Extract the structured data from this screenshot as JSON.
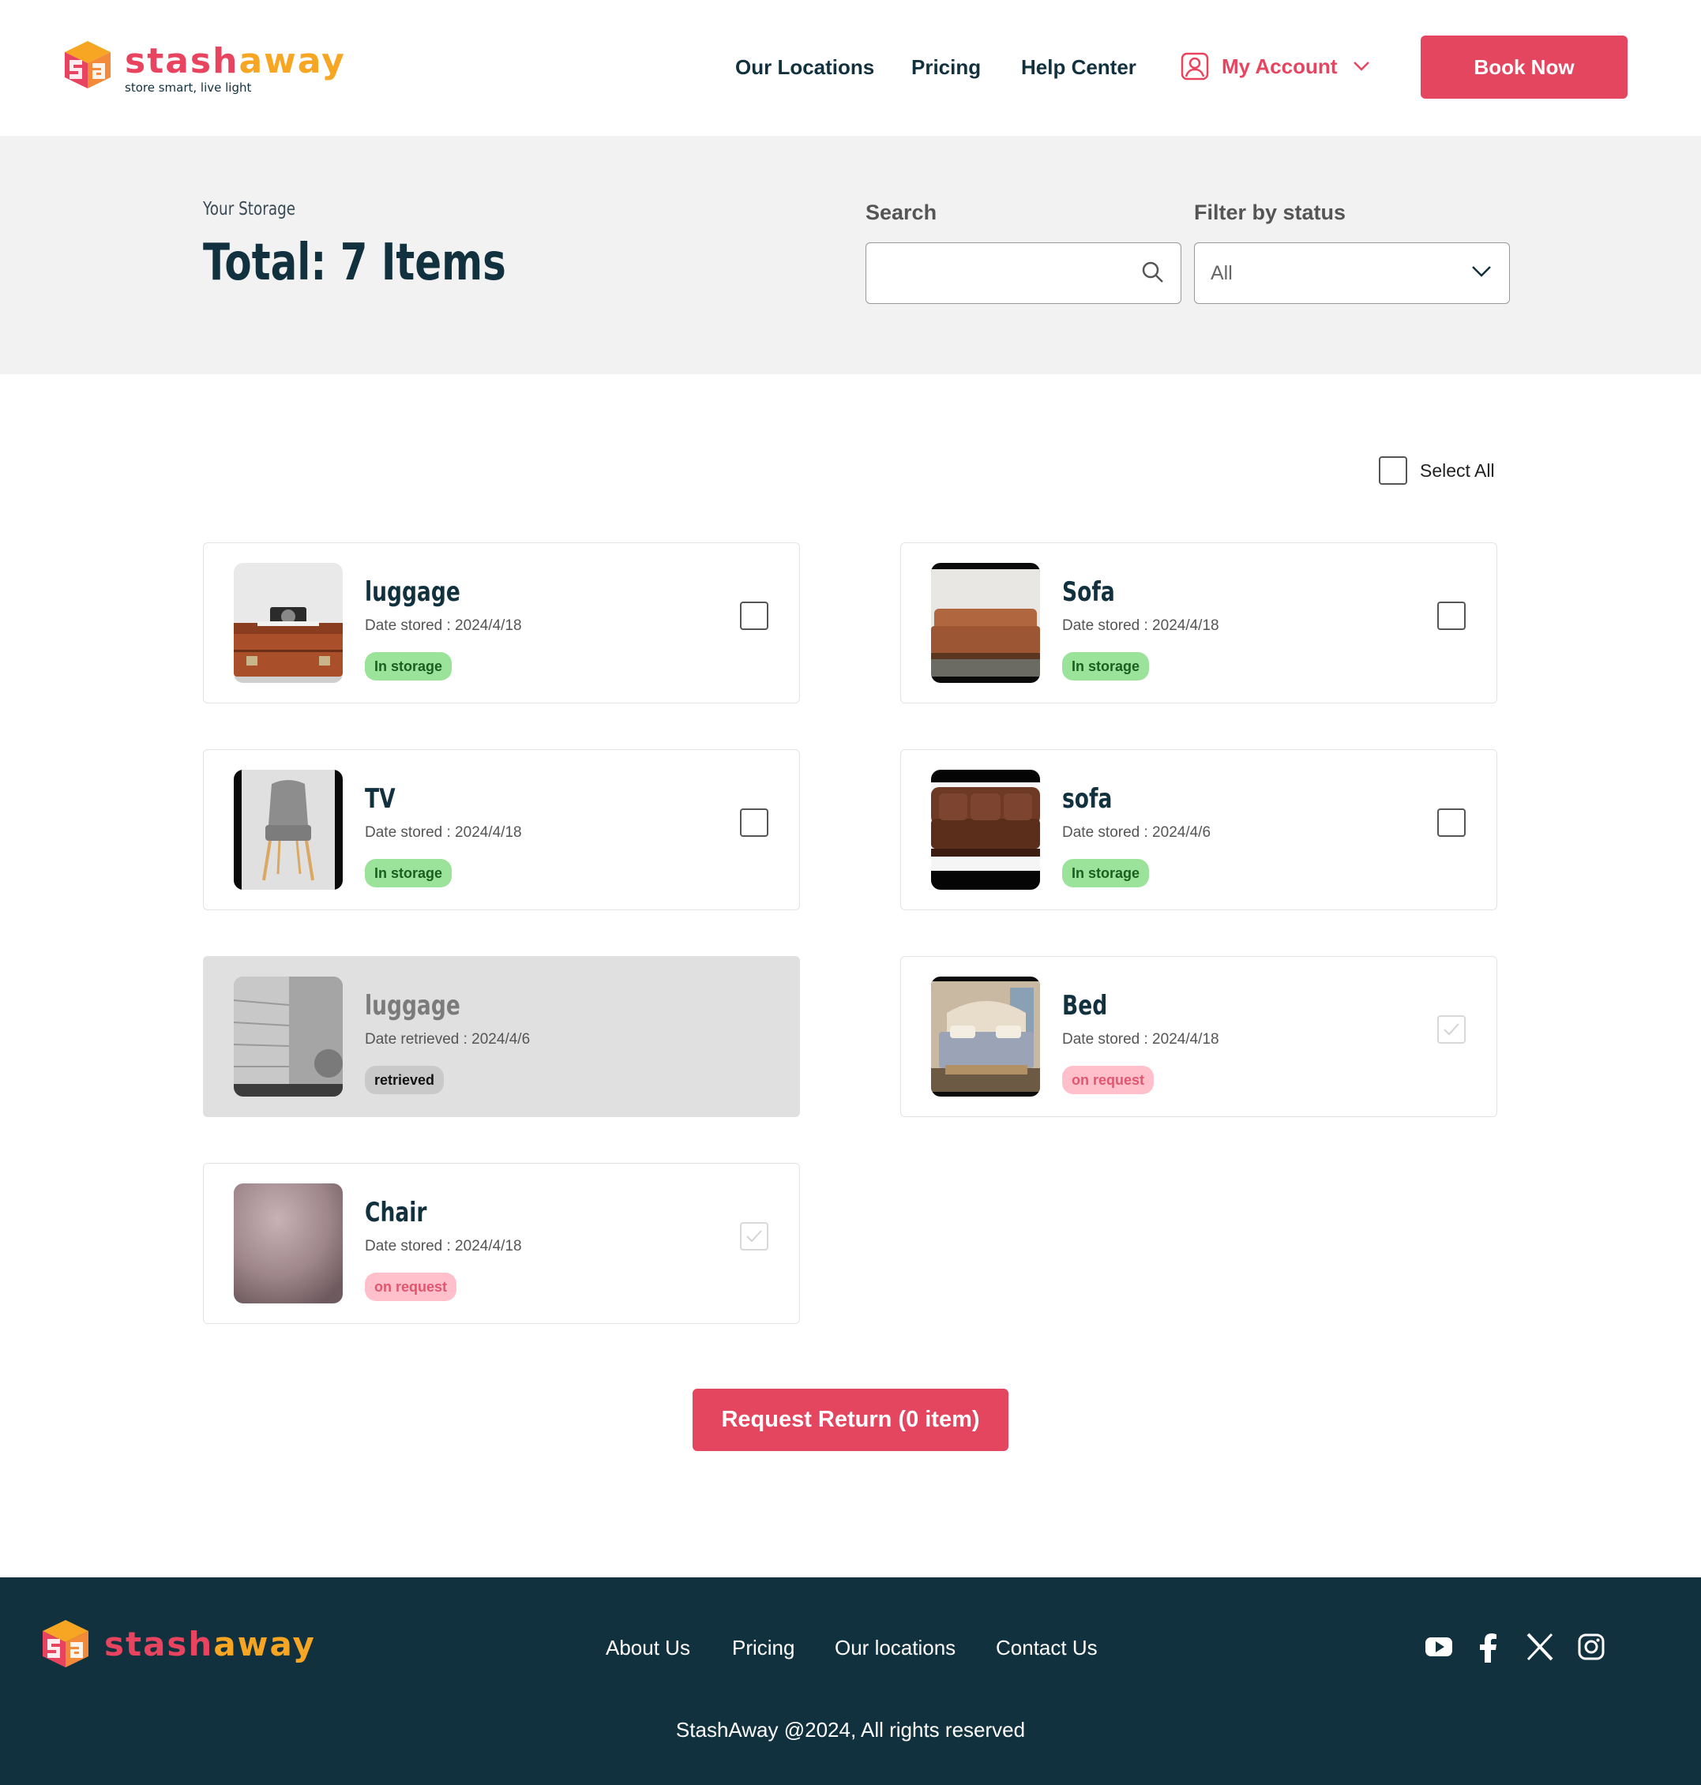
{
  "brand": {
    "name_part1": "stash",
    "name_part2": "away",
    "tagline": "store smart, live light",
    "colors": {
      "primary": "#e4465f",
      "secondary": "#f6a623",
      "dark": "#12313f"
    }
  },
  "nav": {
    "locations": "Our Locations",
    "pricing": "Pricing",
    "help": "Help Center",
    "account": "My Account",
    "book": "Book Now"
  },
  "storage": {
    "eyebrow": "Your Storage",
    "total": "Total: 7 Items",
    "search_label": "Search",
    "search_value": "",
    "filter_label": "Filter by status",
    "filter_value": "All"
  },
  "select_all": "Select All",
  "items": [
    {
      "title": "luggage",
      "date": "Date stored : 2024/4/18",
      "status": "In storage",
      "status_color": "green",
      "checked": false,
      "disabled": false,
      "image": "luggage-photo"
    },
    {
      "title": "Sofa",
      "date": "Date stored : 2024/4/18",
      "status": "In storage",
      "status_color": "green",
      "checked": false,
      "disabled": false,
      "image": "sofa-photo"
    },
    {
      "title": "TV",
      "date": "Date stored : 2024/4/18",
      "status": "In storage",
      "status_color": "green",
      "checked": false,
      "disabled": false,
      "image": "chair-photo"
    },
    {
      "title": "sofa",
      "date": "Date stored : 2024/4/6",
      "status": "In storage",
      "status_color": "green",
      "checked": false,
      "disabled": false,
      "image": "leather-sofa-photo"
    },
    {
      "title": "luggage",
      "date": "Date retrieved : 2024/4/6",
      "status": "retrieved",
      "status_color": "grey",
      "checked": false,
      "disabled": true,
      "image": "grey-photo"
    },
    {
      "title": "Bed",
      "date": "Date stored : 2024/4/18",
      "status": "on request",
      "status_color": "pink",
      "checked": true,
      "disabled": true,
      "image": "bed-photo"
    },
    {
      "title": "Chair",
      "date": "Date stored : 2024/4/18",
      "status": "on request",
      "status_color": "pink",
      "checked": true,
      "disabled": true,
      "image": "blurred-photo"
    }
  ],
  "request_button": "Request Return (0 item)",
  "footer": {
    "links": [
      "About Us",
      "Pricing",
      "Our locations",
      "Contact Us"
    ],
    "social": [
      "youtube-icon",
      "facebook-icon",
      "x-icon",
      "instagram-icon"
    ],
    "copyright": "StashAway @2024, All rights reserved"
  }
}
